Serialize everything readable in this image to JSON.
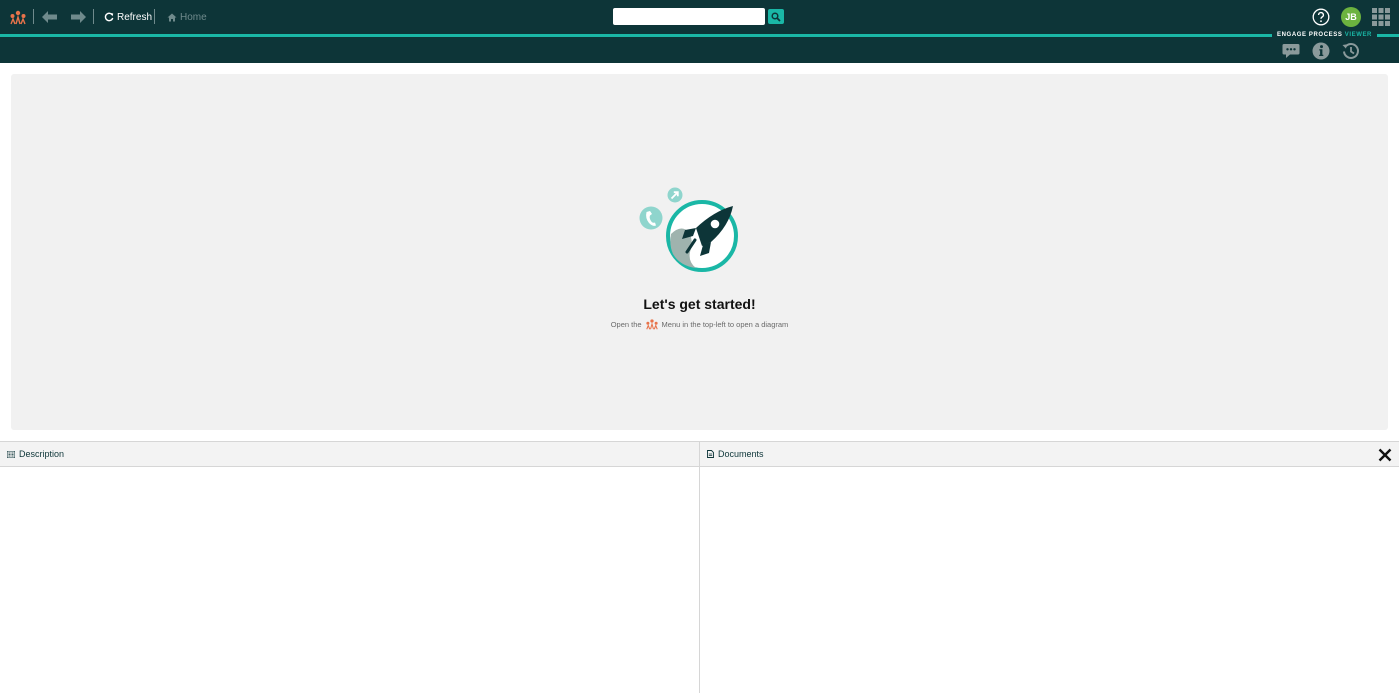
{
  "toolbar": {
    "refresh_label": "Refresh",
    "home_label": "Home",
    "search_placeholder": "",
    "avatar_initials": "JB",
    "brand_main": "ENGAGE PROCESS",
    "brand_accent": "VIEWER"
  },
  "empty_state": {
    "title": "Let's get started!",
    "subtitle_before": "Open the",
    "subtitle_after": "Menu in the top-left to open a diagram"
  },
  "panels": {
    "description_title": "Description",
    "documents_title": "Documents"
  },
  "colors": {
    "header_bg": "#0d3538",
    "accent": "#1ab7a6",
    "logo_orange": "#e8734a",
    "avatar_green": "#6cb33f",
    "canvas_bg": "#f1f1f1"
  }
}
